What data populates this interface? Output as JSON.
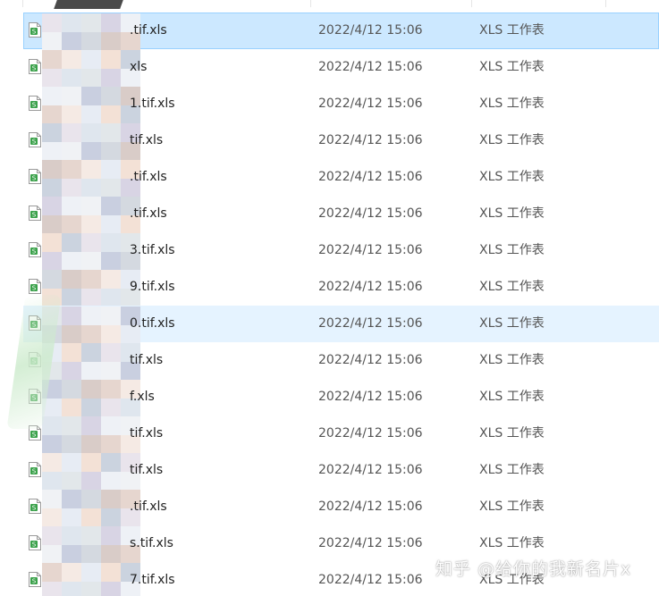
{
  "columns": {
    "dividers": 4
  },
  "colors": {
    "selected_bg": "#cce8ff",
    "hover_bg": "#e5f3ff",
    "icon_green": "#3aa14a"
  },
  "files": [
    {
      "name_prefix": "g",
      "name_suffix": ".tif.xls",
      "date": "2022/4/12 15:06",
      "type": "XLS 工作表",
      "state": "selected"
    },
    {
      "name_prefix": "",
      "name_suffix": "xls",
      "date": "2022/4/12 15:06",
      "type": "XLS 工作表",
      "state": ""
    },
    {
      "name_prefix": "",
      "name_suffix": "1.tif.xls",
      "date": "2022/4/12 15:06",
      "type": "XLS 工作表",
      "state": ""
    },
    {
      "name_prefix": "",
      "name_suffix": "tif.xls",
      "date": "2022/4/12 15:06",
      "type": "XLS 工作表",
      "state": ""
    },
    {
      "name_prefix": "",
      "name_suffix": ".tif.xls",
      "date": "2022/4/12 15:06",
      "type": "XLS 工作表",
      "state": ""
    },
    {
      "name_prefix": "",
      "name_suffix": ".tif.xls",
      "date": "2022/4/12 15:06",
      "type": "XLS 工作表",
      "state": ""
    },
    {
      "name_prefix": "",
      "name_suffix": "3.tif.xls",
      "date": "2022/4/12 15:06",
      "type": "XLS 工作表",
      "state": ""
    },
    {
      "name_prefix": "",
      "name_suffix": "9.tif.xls",
      "date": "2022/4/12 15:06",
      "type": "XLS 工作表",
      "state": ""
    },
    {
      "name_prefix": "",
      "name_suffix": "0.tif.xls",
      "date": "2022/4/12 15:06",
      "type": "XLS 工作表",
      "state": "hover"
    },
    {
      "name_prefix": "g",
      "name_suffix": "tif.xls",
      "date": "2022/4/12 15:06",
      "type": "XLS 工作表",
      "state": ""
    },
    {
      "name_prefix": "g",
      "name_suffix": "f.xls",
      "date": "2022/4/12 15:06",
      "type": "XLS 工作表",
      "state": ""
    },
    {
      "name_prefix": "g",
      "name_suffix": "tif.xls",
      "date": "2022/4/12 15:06",
      "type": "XLS 工作表",
      "state": ""
    },
    {
      "name_prefix": "",
      "name_suffix": "tif.xls",
      "date": "2022/4/12 15:06",
      "type": "XLS 工作表",
      "state": ""
    },
    {
      "name_prefix": "",
      "name_suffix": ".tif.xls",
      "date": "2022/4/12 15:06",
      "type": "XLS 工作表",
      "state": ""
    },
    {
      "name_prefix": "",
      "name_suffix": "s.tif.xls",
      "date": "2022/4/12 15:06",
      "type": "XLS 工作表",
      "state": ""
    },
    {
      "name_prefix": "",
      "name_suffix": "7.tif.xls",
      "date": "2022/4/12 15:06",
      "type": "XLS 工作表",
      "state": ""
    }
  ],
  "watermark": "知乎 @给你的我新名片x"
}
